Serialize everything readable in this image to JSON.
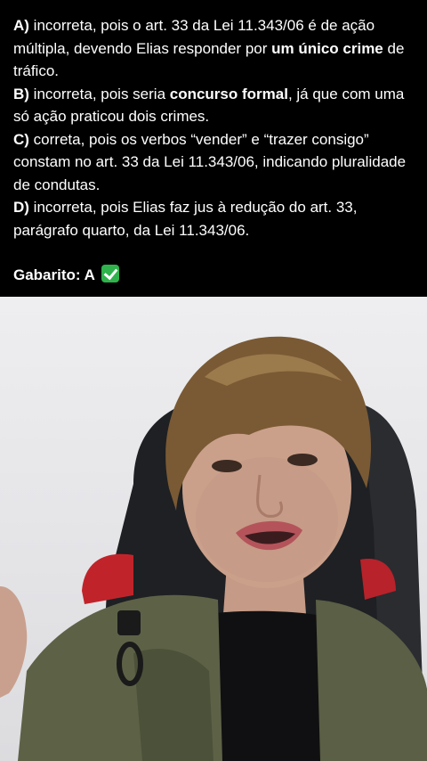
{
  "question": {
    "options": [
      {
        "letter": "A)",
        "pre": " incorreta, pois o art. 33 da Lei 11.343/06 é de ação múltipla, devendo Elias responder por ",
        "bold": "um único crime",
        "post": " de tráfico."
      },
      {
        "letter": "B)",
        "pre": " incorreta, pois seria ",
        "bold": "concurso formal",
        "post": ", já que com uma só ação praticou dois crimes."
      },
      {
        "letter": "C)",
        "pre": " correta, pois os verbos “vender” e “trazer consigo” constam no art. 33 da Lei 11.343/06, indicando pluralidade de condutas.",
        "bold": "",
        "post": ""
      },
      {
        "letter": "D)",
        "pre": " incorreta, pois Elias faz jus à redução do art. 33, parágrafo quarto, da Lei 11.343/06.",
        "bold": "",
        "post": ""
      }
    ],
    "answer_label": "Gabarito: A",
    "answer_icon": "check-mark-icon"
  },
  "video": {
    "subject": "woman-speaking-to-camera",
    "colors": {
      "background": "#e9e9ec",
      "hair": "#7a5a34",
      "vest": "#5d6247",
      "chair": "#1e2023",
      "chair_accent": "#c0242a"
    }
  }
}
